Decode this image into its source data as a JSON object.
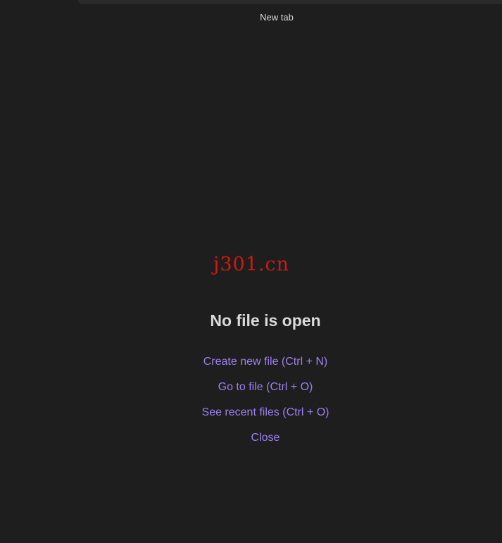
{
  "tab": {
    "title": "New tab"
  },
  "watermark": {
    "text": "j301.cn"
  },
  "empty_state": {
    "title": "No file is open",
    "actions": [
      {
        "label": "Create new file (Ctrl + N)"
      },
      {
        "label": "Go to file (Ctrl + O)"
      },
      {
        "label": "See recent files (Ctrl + O)"
      },
      {
        "label": "Close"
      }
    ]
  },
  "colors": {
    "background": "#1e1e1e",
    "link": "#9c80f0",
    "text": "#dadada",
    "watermark": "#cc1b10"
  }
}
